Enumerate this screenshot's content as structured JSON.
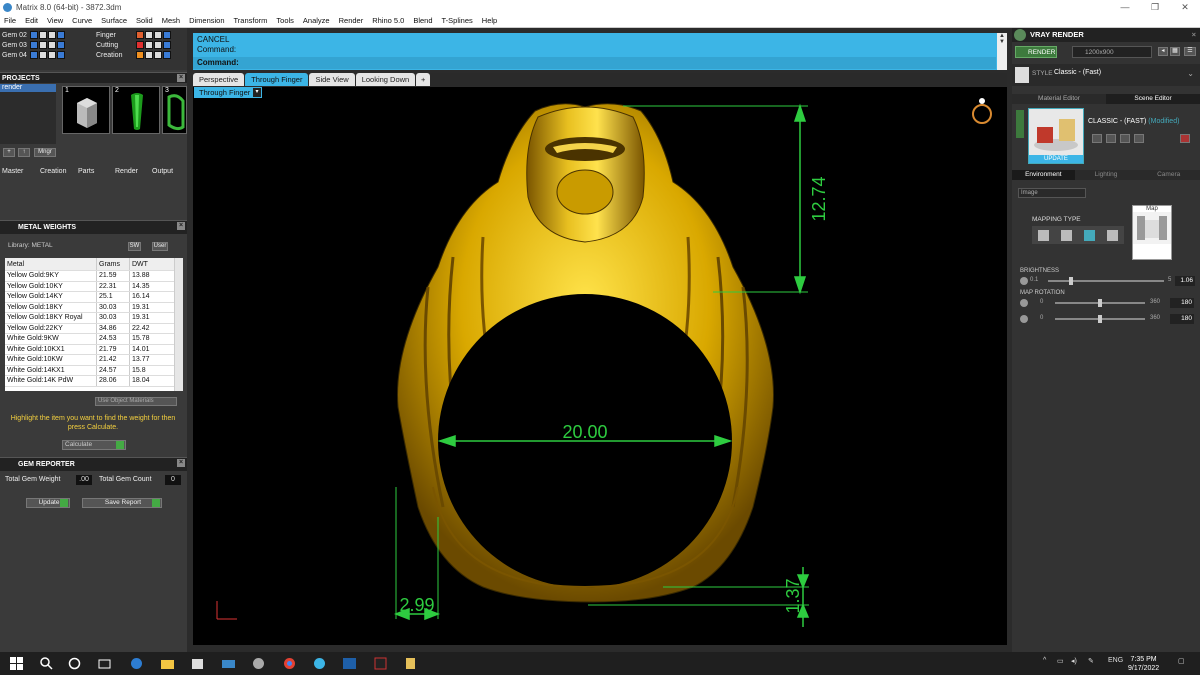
{
  "window": {
    "title": "Matrix 8.0 (64-bit) - 3872.3dm",
    "controls": [
      "—",
      "❐",
      "✕"
    ]
  },
  "menu": [
    "File",
    "Edit",
    "View",
    "Curve",
    "Surface",
    "Solid",
    "Mesh",
    "Dimension",
    "Transform",
    "Tools",
    "Analyze",
    "Render",
    "Rhino 5.0",
    "Blend",
    "T-Splines",
    "Help"
  ],
  "layers": {
    "left": [
      "Gem 02",
      "Gem 03",
      "Gem 04"
    ],
    "right": [
      "Finger",
      "Cutting",
      "Creation"
    ]
  },
  "projects": {
    "title": "PROJECTS",
    "tree_item": "render",
    "thumb_numbers": [
      "1",
      "2",
      "3"
    ],
    "mngr_label": "Mngr",
    "tabs": [
      "Master",
      "Creation",
      "Parts",
      "Render",
      "Output"
    ]
  },
  "metal_weights": {
    "title": "METAL WEIGHTS",
    "library_label": "Library: METAL",
    "sw_label": "SW",
    "user_label": "User",
    "columns": [
      "Metal",
      "Grams",
      "DWT"
    ],
    "rows": [
      [
        "Yellow Gold:9KY",
        "21.59",
        "13.88"
      ],
      [
        "Yellow Gold:10KY",
        "22.31",
        "14.35"
      ],
      [
        "Yellow Gold:14KY",
        "25.1",
        "16.14"
      ],
      [
        "Yellow Gold:18KY",
        "30.03",
        "19.31"
      ],
      [
        "Yellow Gold:18KY Royal",
        "30.03",
        "19.31"
      ],
      [
        "Yellow Gold:22KY",
        "34.86",
        "22.42"
      ],
      [
        "White Gold:9KW",
        "24.53",
        "15.78"
      ],
      [
        "White Gold:10KX1",
        "21.79",
        "14.01"
      ],
      [
        "White Gold:10KW",
        "21.42",
        "13.77"
      ],
      [
        "White Gold:14KX1",
        "24.57",
        "15.8"
      ],
      [
        "White Gold:14K PdW",
        "28.06",
        "18.04"
      ]
    ],
    "use_object_materials": "Use Object Materials",
    "hint": "Highlight the item you want to find the weight for then press Calculate.",
    "calculate_label": "Calculate"
  },
  "gem_reporter": {
    "title": "GEM REPORTER",
    "total_weight_label": "Total Gem Weight",
    "total_weight_value": ".00",
    "total_count_label": "Total Gem Count",
    "total_count_value": "0",
    "update_label": "Update",
    "save_report_label": "Save Report"
  },
  "command": {
    "line1": "CANCEL",
    "line2": "Command:",
    "prompt": "Command:"
  },
  "viewport": {
    "tabs": [
      "Perspective",
      "Through Finger",
      "Side View",
      "Looking Down"
    ],
    "active_tab": "Through Finger",
    "view_label": "Through Finger",
    "dimensions": {
      "inner_diameter": "20.00",
      "head_height": "12.74",
      "shank_width": "2.99",
      "shank_thickness": "1.37"
    },
    "dim_color": "#2ecc40",
    "metal_color": "#d4a500"
  },
  "vray": {
    "title": "VRAY RENDER",
    "render_label": "RENDER",
    "resolution": "1200x900",
    "style_label": "STYLE",
    "style_value": "Classic - (Fast)",
    "tabs": [
      "Material Editor",
      "Scene Editor"
    ],
    "active_tab": "Scene Editor",
    "preset_name": "CLASSIC - (FAST)",
    "preset_modified": "(Modified)",
    "update_label": "UPDATE",
    "env_tabs": [
      "Environment",
      "Lighting",
      "Camera"
    ],
    "env_active": "Environment",
    "env_dropdown": "Image",
    "mapping_type_label": "MAPPING TYPE",
    "map_label": "Map",
    "brightness_label": "BRIGHTNESS",
    "brightness": {
      "min": "0.1",
      "max": "5",
      "value": "1.06",
      "fraction": 0.2
    },
    "map_rotation_label": "MAP ROTATION",
    "rotation1": {
      "min": "0",
      "max": "360",
      "value": "180",
      "fraction": 0.5
    },
    "rotation2": {
      "min": "0",
      "max": "360",
      "value": "180",
      "fraction": 0.5
    }
  },
  "taskbar": {
    "language": "ENG",
    "time": "7:35 PM",
    "date": "9/17/2022"
  }
}
